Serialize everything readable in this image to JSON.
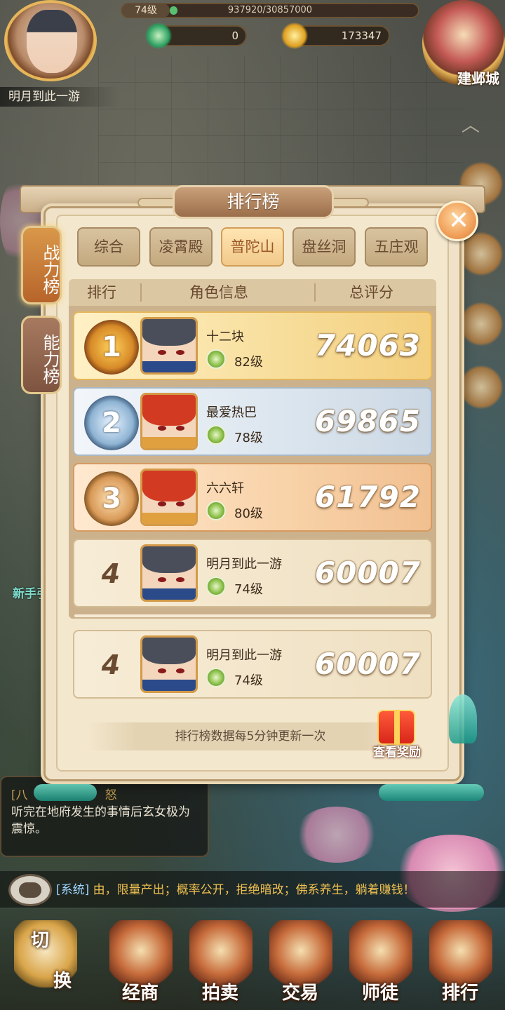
{
  "hud": {
    "player_name": "明月到此一游",
    "level": "74级",
    "exp": "937920/30857000",
    "exp_fraction": 0.03,
    "currency_jade": "0",
    "currency_gold": "173347",
    "city_button": "建邺城"
  },
  "ranking": {
    "title": "排行榜",
    "side_tabs": [
      {
        "label": "战力榜",
        "active": true
      },
      {
        "label": "能力榜",
        "active": false
      }
    ],
    "tabs": [
      {
        "label": "综合",
        "active": false
      },
      {
        "label": "凌霄殿",
        "active": false
      },
      {
        "label": "普陀山",
        "active": true
      },
      {
        "label": "盘丝洞",
        "active": false
      },
      {
        "label": "五庄观",
        "active": false
      }
    ],
    "columns": {
      "rank": "排行",
      "info": "角色信息",
      "score": "总评分"
    },
    "rows": [
      {
        "rank": "1",
        "name": "十二块",
        "level": "82级",
        "score": "74063"
      },
      {
        "rank": "2",
        "name": "最爱热巴",
        "level": "78级",
        "score": "69865"
      },
      {
        "rank": "3",
        "name": "六六轩",
        "level": "80级",
        "score": "61792"
      },
      {
        "rank": "4",
        "name": "明月到此一游",
        "level": "74级",
        "score": "60007"
      }
    ],
    "self_row": {
      "rank": "4",
      "name": "明月到此一游",
      "level": "74级",
      "score": "60007"
    },
    "notice": "排行榜数据每5分钟更新一次",
    "reward_button": "查看奖励",
    "close_icon": "close-icon"
  },
  "quest": {
    "title": "[八",
    "title_tail": "怒",
    "text": "听完在地府发生的事情后玄女极为震惊。"
  },
  "newbie_label": "新手引",
  "chat": {
    "tag": "[系统]",
    "message": "由，限量产出；概率公开，拒绝暗改；佛系养生，躺着赚钱！"
  },
  "bottom_nav": {
    "switch_top": "切",
    "switch_bottom": "换",
    "items": [
      "经商",
      "拍卖",
      "交易",
      "师徒",
      "排行"
    ]
  },
  "colors": {
    "panel_bg": "#efe2c8",
    "active_tab": "#f1c98a",
    "score_text": "#ffffff",
    "chat_text": "#f0c050"
  }
}
